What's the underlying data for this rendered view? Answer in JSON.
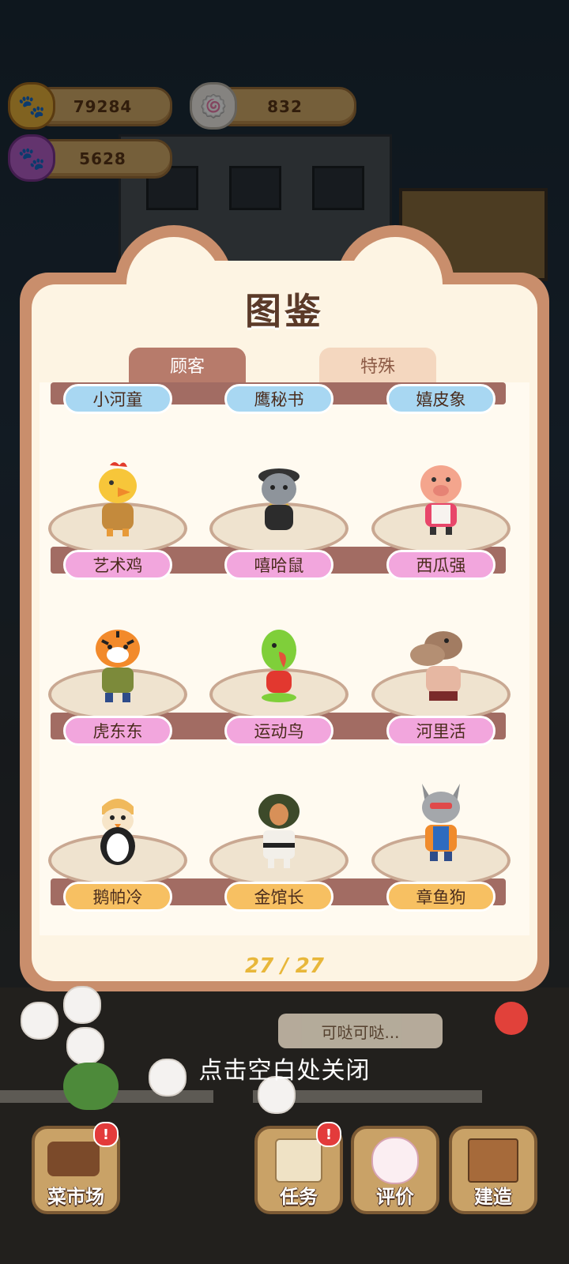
{
  "currency": {
    "coins": "79284",
    "chef_hats": "832",
    "paw_points": "5628"
  },
  "panel": {
    "title": "图鉴",
    "tabs": [
      {
        "label": "顾客",
        "active": true
      },
      {
        "label": "特殊",
        "active": false
      }
    ],
    "page_indicator": "27 / 27"
  },
  "customers": [
    {
      "name": "小河童",
      "icon": "kappa-character-icon",
      "tag_color": "blue"
    },
    {
      "name": "鹰秘书",
      "icon": "eagle-character-icon",
      "tag_color": "blue"
    },
    {
      "name": "嬉皮象",
      "icon": "elephant-character-icon",
      "tag_color": "blue"
    },
    {
      "name": "艺术鸡",
      "icon": "rooster-character-icon",
      "tag_color": "pink"
    },
    {
      "name": "嘻哈鼠",
      "icon": "rat-character-icon",
      "tag_color": "pink"
    },
    {
      "name": "西瓜强",
      "icon": "pig-character-icon",
      "tag_color": "pink"
    },
    {
      "name": "虎东东",
      "icon": "tiger-character-icon",
      "tag_color": "pink"
    },
    {
      "name": "运动鸟",
      "icon": "parrot-character-icon",
      "tag_color": "pink"
    },
    {
      "name": "河里活",
      "icon": "hippo-character-icon",
      "tag_color": "pink"
    },
    {
      "name": "鹅帕冷",
      "icon": "penguin-character-icon",
      "tag_color": "gold"
    },
    {
      "name": "金馆长",
      "icon": "karate-master-character-icon",
      "tag_color": "gold"
    },
    {
      "name": "章鱼狗",
      "icon": "wolf-dog-character-icon",
      "tag_color": "gold"
    }
  ],
  "hint": "点击空白处关闭",
  "speech_bubble": "可哒可哒...",
  "bottom_bar": [
    {
      "label": "菜市场",
      "icon": "vegetable-basket-icon",
      "badge": "!"
    },
    {
      "label": "任务",
      "icon": "task-scroll-icon",
      "badge": "!"
    },
    {
      "label": "评价",
      "icon": "smiley-face-icon",
      "badge": ""
    },
    {
      "label": "建造",
      "icon": "build-shop-icon",
      "badge": ""
    }
  ],
  "colors": {
    "panel_border": "#c98e6c",
    "panel_fill": "#fdf4e3",
    "tag_blue": "#a8d7f2",
    "tag_pink": "#f2a6dd",
    "tag_gold": "#f7c062",
    "page_indicator": "#e8b73a"
  }
}
